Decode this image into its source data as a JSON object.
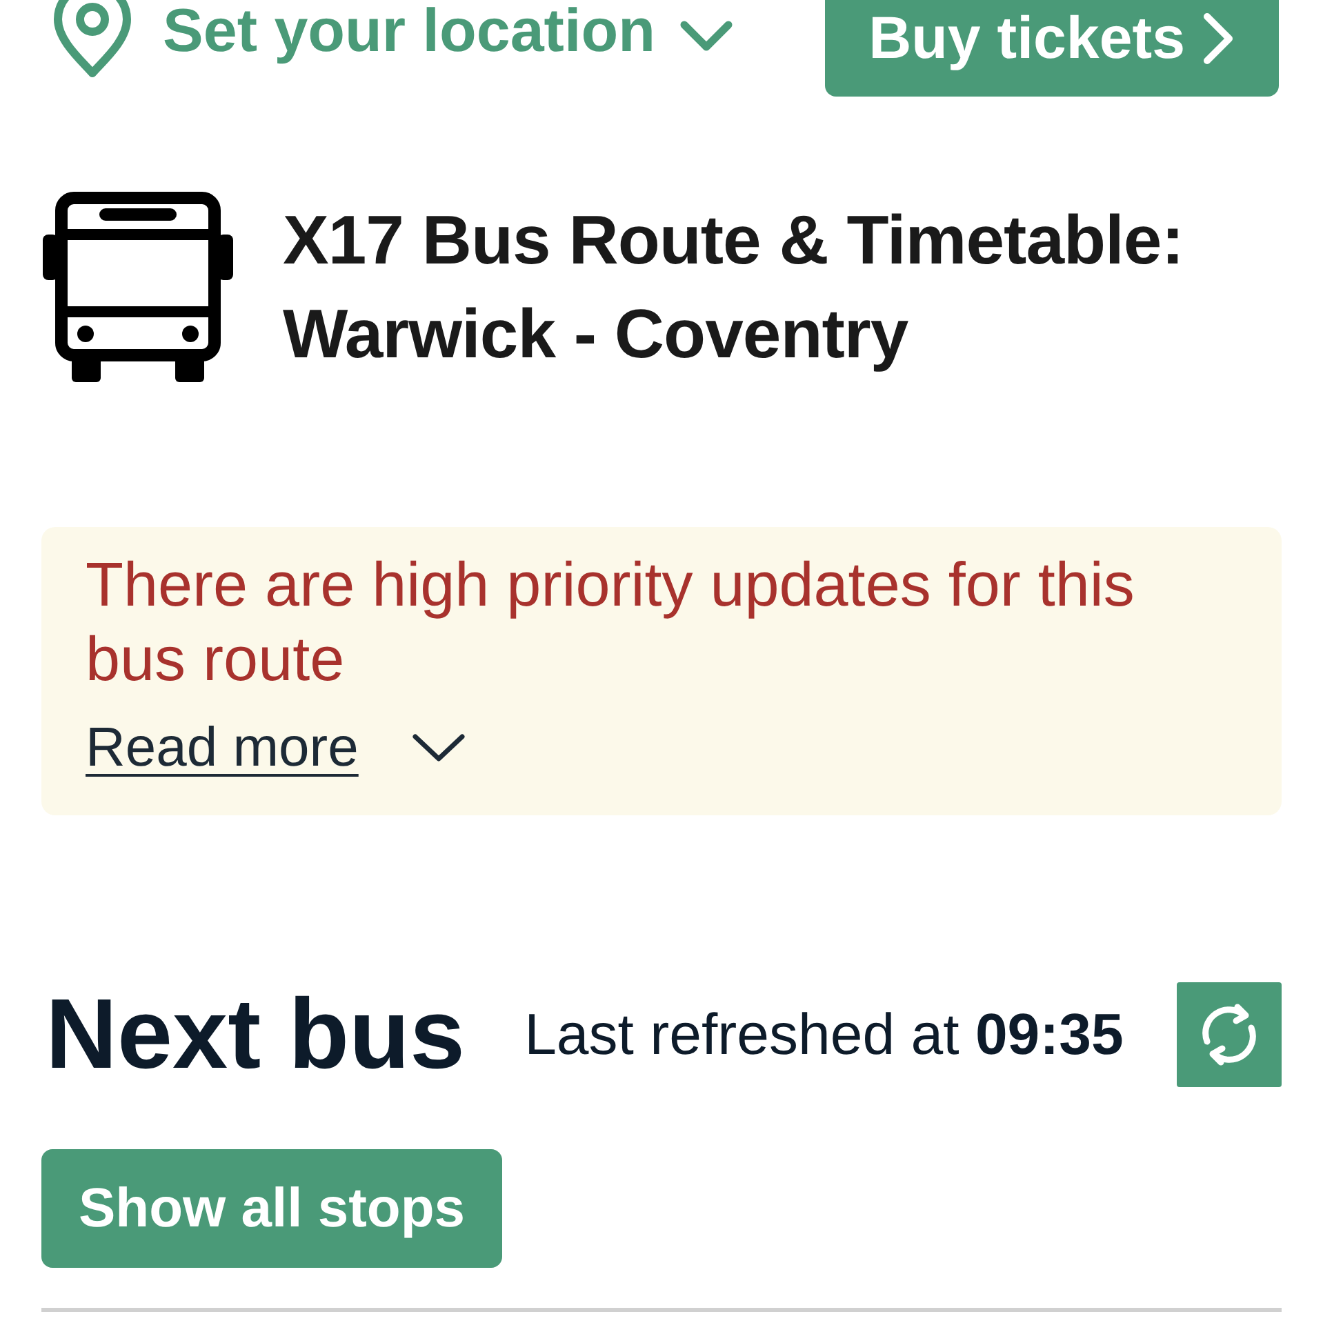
{
  "top_bar": {
    "location_label": "Set your location",
    "buy_button": "Buy tickets"
  },
  "route": {
    "title": "X17 Bus Route & Timetable: Warwick - Coventry"
  },
  "alert": {
    "message": "There are high priority updates for this bus route",
    "link": "Read more",
    "expanded": false
  },
  "next_bus": {
    "heading": "Next bus",
    "refreshed_label": "Last refreshed at **09:35**",
    "show_all_button": "Show all stops"
  }
}
